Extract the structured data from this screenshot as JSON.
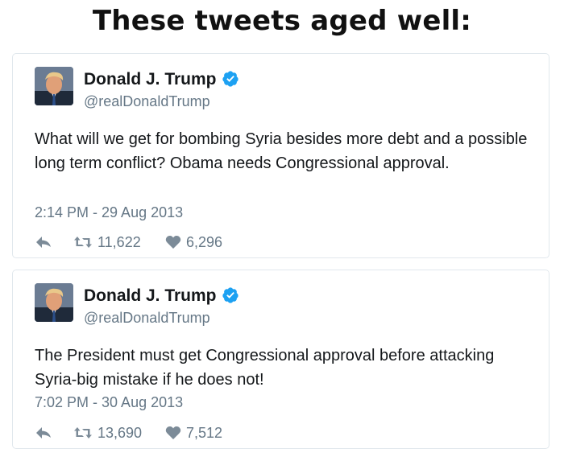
{
  "meme": {
    "title": "These tweets aged well:"
  },
  "colors": {
    "verified": "#1da1f2",
    "secondary_text": "#657786",
    "icon": "#7c8b98"
  },
  "tweets": [
    {
      "author_name": "Donald J. Trump",
      "handle": "@realDonaldTrump",
      "verified": true,
      "text": "What will we get for bombing Syria besides more debt and a possible long term conflict? Obama needs Congressional approval.",
      "timestamp": "2:14 PM - 29 Aug 2013",
      "retweets": "11,622",
      "likes": "6,296"
    },
    {
      "author_name": "Donald J. Trump",
      "handle": "@realDonaldTrump",
      "verified": true,
      "text": "The President must get Congressional approval before attacking Syria-big mistake if he does not!",
      "timestamp": "7:02 PM - 30 Aug 2013",
      "retweets": "13,690",
      "likes": "7,512"
    }
  ]
}
